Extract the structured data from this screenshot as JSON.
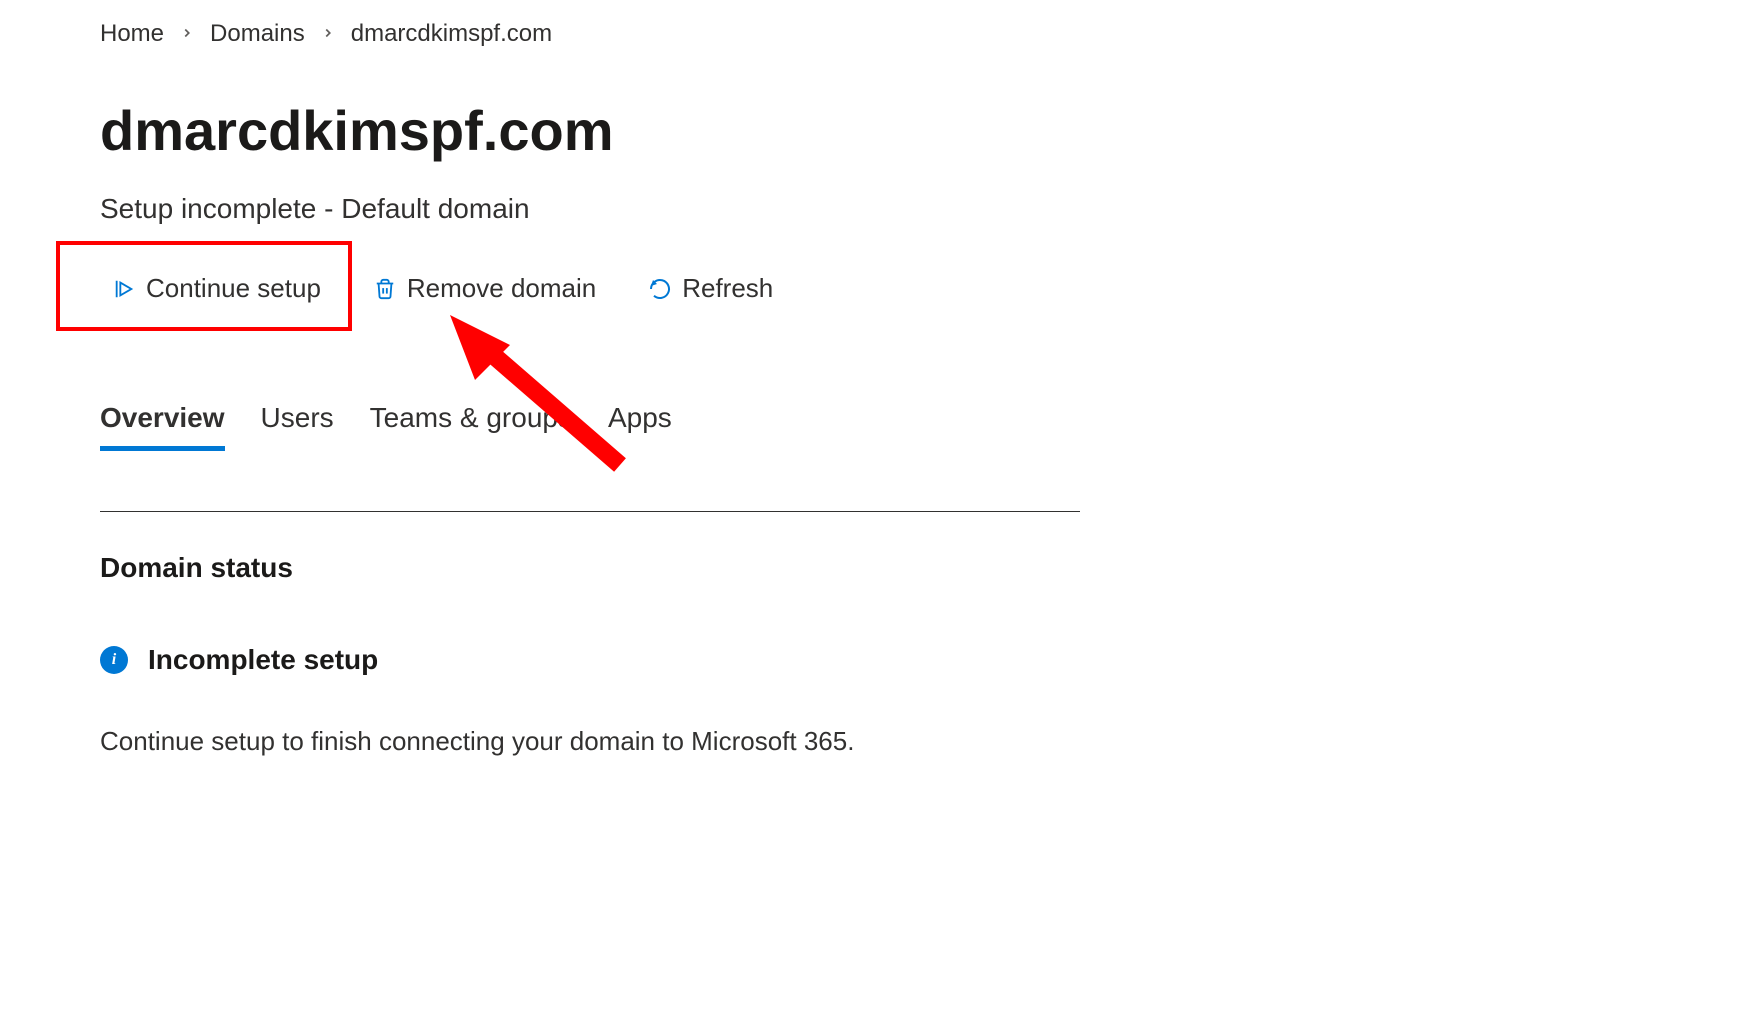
{
  "breadcrumb": {
    "items": [
      "Home",
      "Domains",
      "dmarcdkimspf.com"
    ]
  },
  "title": "dmarcdkimspf.com",
  "subtitle": "Setup incomplete - Default domain",
  "toolbar": {
    "continue_setup": "Continue setup",
    "remove_domain": "Remove domain",
    "refresh": "Refresh"
  },
  "tabs": {
    "overview": "Overview",
    "users": "Users",
    "teams_groups": "Teams & groups",
    "apps": "Apps",
    "active": 0
  },
  "domain_status": {
    "heading": "Domain status",
    "status_label": "Incomplete setup",
    "description": "Continue setup to finish connecting your domain to Microsoft 365."
  },
  "annotation": {
    "highlight": "continue-setup-button",
    "arrow": true
  }
}
